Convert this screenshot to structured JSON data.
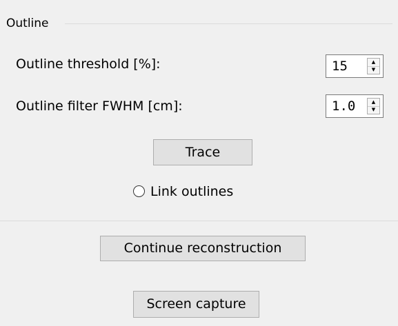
{
  "outline_group": {
    "title": "Outline",
    "threshold": {
      "label": "Outline threshold [%]:",
      "value": "15",
      "up_icon": "arrow-up-icon",
      "down_icon": "arrow-down-icon"
    },
    "filter": {
      "label": "Outline filter FWHM [cm]:",
      "value": "1.0",
      "up_icon": "arrow-up-icon",
      "down_icon": "arrow-down-icon"
    },
    "trace_button": "Trace",
    "link_outlines": {
      "label": "Link outlines",
      "checked": false
    }
  },
  "actions": {
    "continue_button": "Continue reconstruction",
    "capture_button": "Screen capture"
  },
  "colors": {
    "background": "#f0f0f0",
    "button_face": "#e1e1e1",
    "button_border": "#adadad"
  }
}
